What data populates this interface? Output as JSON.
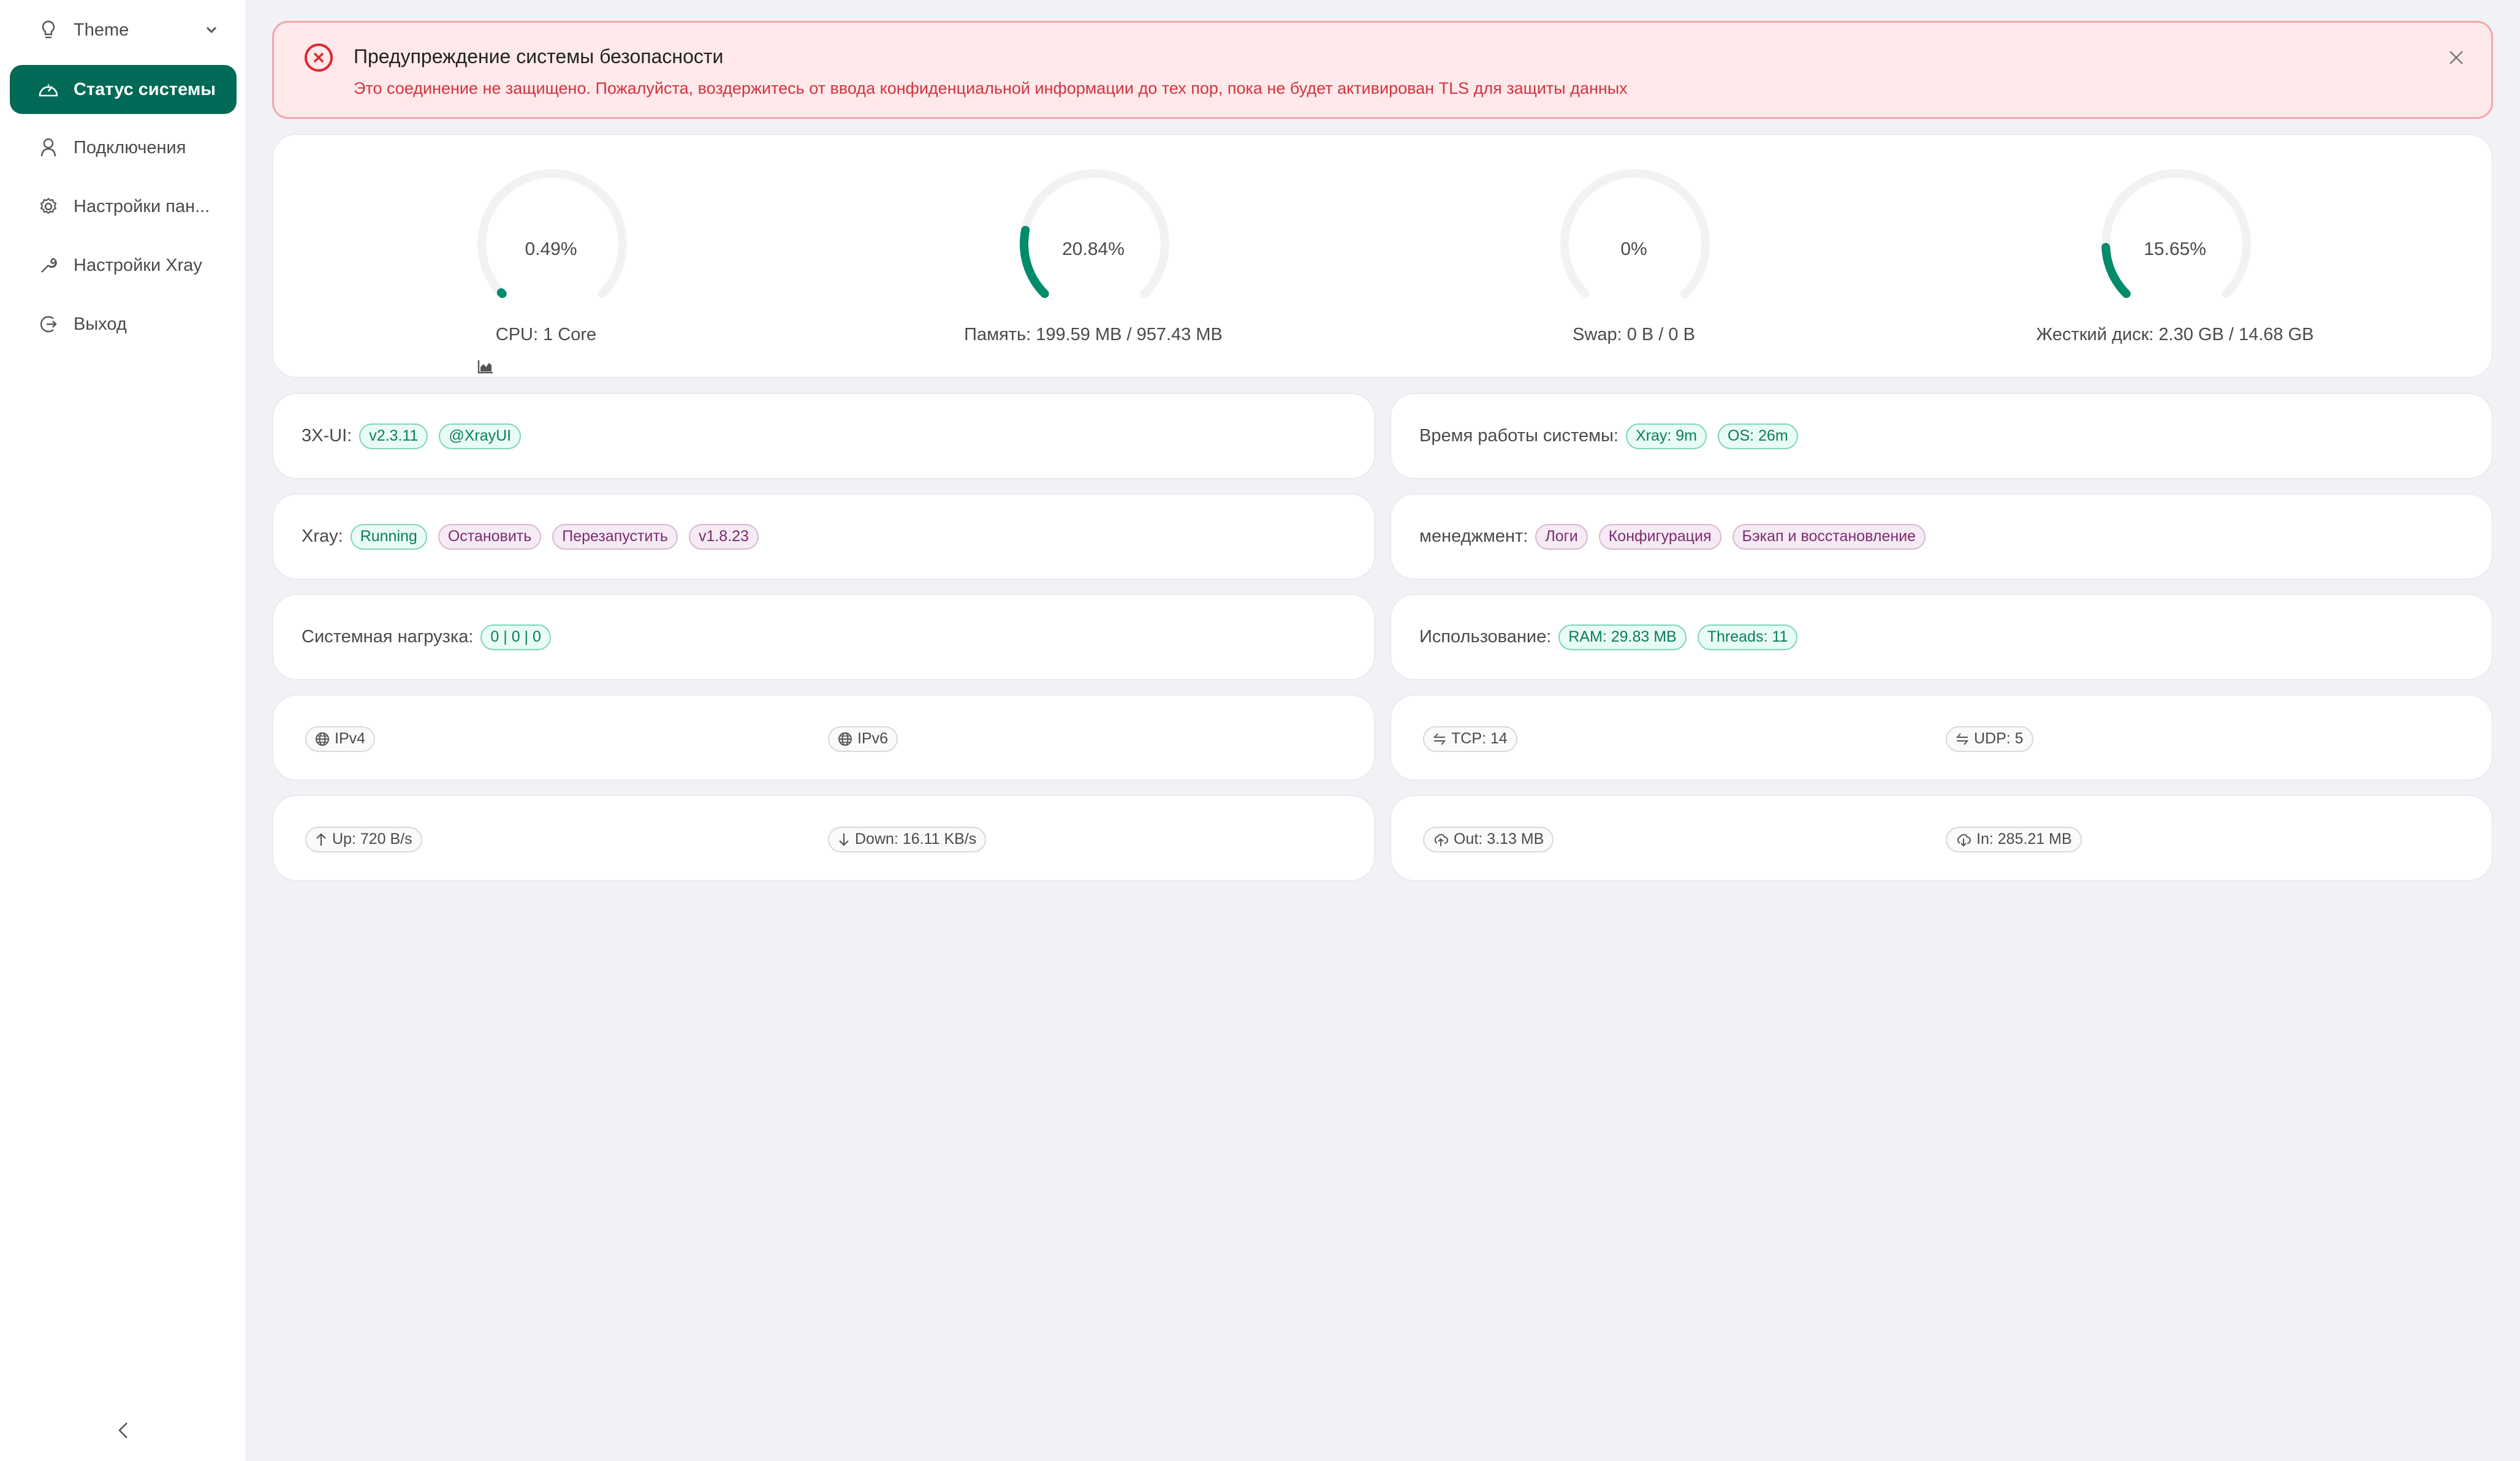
{
  "sidebar": {
    "items": [
      {
        "label": "Theme",
        "icon": "bulb-icon"
      },
      {
        "label": "Статус системы",
        "icon": "dashboard-icon",
        "active": true
      },
      {
        "label": "Подключения",
        "icon": "user-icon"
      },
      {
        "label": "Настройки пан...",
        "icon": "setting-icon"
      },
      {
        "label": "Настройки Xray",
        "icon": "tool-icon"
      },
      {
        "label": "Выход",
        "icon": "logout-icon"
      }
    ],
    "collapse_icon": "chevron-left-icon"
  },
  "alert": {
    "title": "Предупреждение системы безопасности",
    "description": "Это соединение не защищено. Пожалуйста, воздержитесь от ввода конфиденциальной информации до тех пор, пока не будет активирован TLS для защиты данных",
    "type": "error"
  },
  "gauges": [
    {
      "percent_label": "0.49%",
      "value": 0.49,
      "caption": "CPU: 1 Core",
      "has_chart_icon": true
    },
    {
      "percent_label": "20.84%",
      "value": 20.84,
      "caption": "Память: 199.59 MB / 957.43 MB"
    },
    {
      "percent_label": "0%",
      "value": 0,
      "caption": "Swap: 0 B / 0 B"
    },
    {
      "percent_label": "15.65%",
      "value": 15.65,
      "caption": "Жесткий диск: 2.30 GB / 14.68 GB"
    }
  ],
  "colors": {
    "accent": "#006a57",
    "gauge_fill": "#008b6b",
    "gauge_track": "#f2f2f2",
    "alert_bg": "#ffe9ea",
    "alert_text": "#d0343f"
  },
  "info": {
    "xui": {
      "label": "3X-UI:",
      "tags": [
        "v2.3.11",
        "@XrayUI"
      ]
    },
    "uptime": {
      "label": "Время работы системы:",
      "tags": [
        "Xray: 9m",
        "OS: 26m"
      ]
    },
    "xray": {
      "label": "Xray:",
      "status": "Running",
      "stop": "Остановить",
      "restart": "Перезапустить",
      "version": "v1.8.23"
    },
    "management": {
      "label": "менеджмент:",
      "logs": "Логи",
      "config": "Конфигурация",
      "backup": "Бэкап и восстановление"
    },
    "load": {
      "label": "Системная нагрузка:",
      "value": "0 | 0 | 0"
    },
    "usage": {
      "label": "Использование:",
      "ram": "RAM: 29.83 MB",
      "threads": "Threads: 11"
    },
    "ipv4": "IPv4",
    "ipv6": "IPv6",
    "tcp": "TCP: 14",
    "udp": "UDP: 5",
    "up": "Up: 720 B/s",
    "down": "Down: 16.11 KB/s",
    "out": "Out: 3.13 MB",
    "in": "In: 285.21 MB"
  }
}
